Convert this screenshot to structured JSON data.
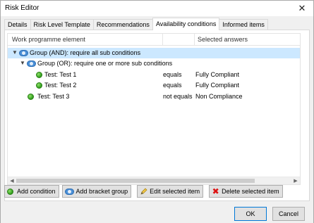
{
  "window": {
    "title": "Risk Editor",
    "close_glyph": "✕"
  },
  "tabs": [
    {
      "label": "Details"
    },
    {
      "label": "Risk Level Template"
    },
    {
      "label": "Recommendations"
    },
    {
      "label": "Availability conditions",
      "active": true
    },
    {
      "label": "Informed items"
    }
  ],
  "tree": {
    "columns": [
      "Work programme element",
      "",
      "Selected answers"
    ],
    "rows": [
      {
        "element": "Group (AND): require all sub conditions",
        "operator": "",
        "answer": "",
        "icon": "group-icon",
        "toggle": "▼",
        "selected": true
      },
      {
        "element": "Group (OR): require one or more sub conditions",
        "operator": "",
        "answer": "",
        "icon": "group-icon",
        "toggle": "▼"
      },
      {
        "element": "Test: Test 1",
        "operator": "equals",
        "answer": "Fully Compliant",
        "icon": "test-icon"
      },
      {
        "element": "Test: Test 2",
        "operator": "equals",
        "answer": "Fully Compliant",
        "icon": "test-icon"
      },
      {
        "element": "Test: Test 3",
        "operator": "not equals",
        "answer": "Non Compliance",
        "icon": "test-icon"
      }
    ]
  },
  "actions": {
    "add_condition": "Add condition",
    "add_bracket_group": "Add bracket group",
    "edit_selected": "Edit selected item",
    "delete_selected": "Delete selected item"
  },
  "footer": {
    "ok": "OK",
    "cancel": "Cancel"
  }
}
